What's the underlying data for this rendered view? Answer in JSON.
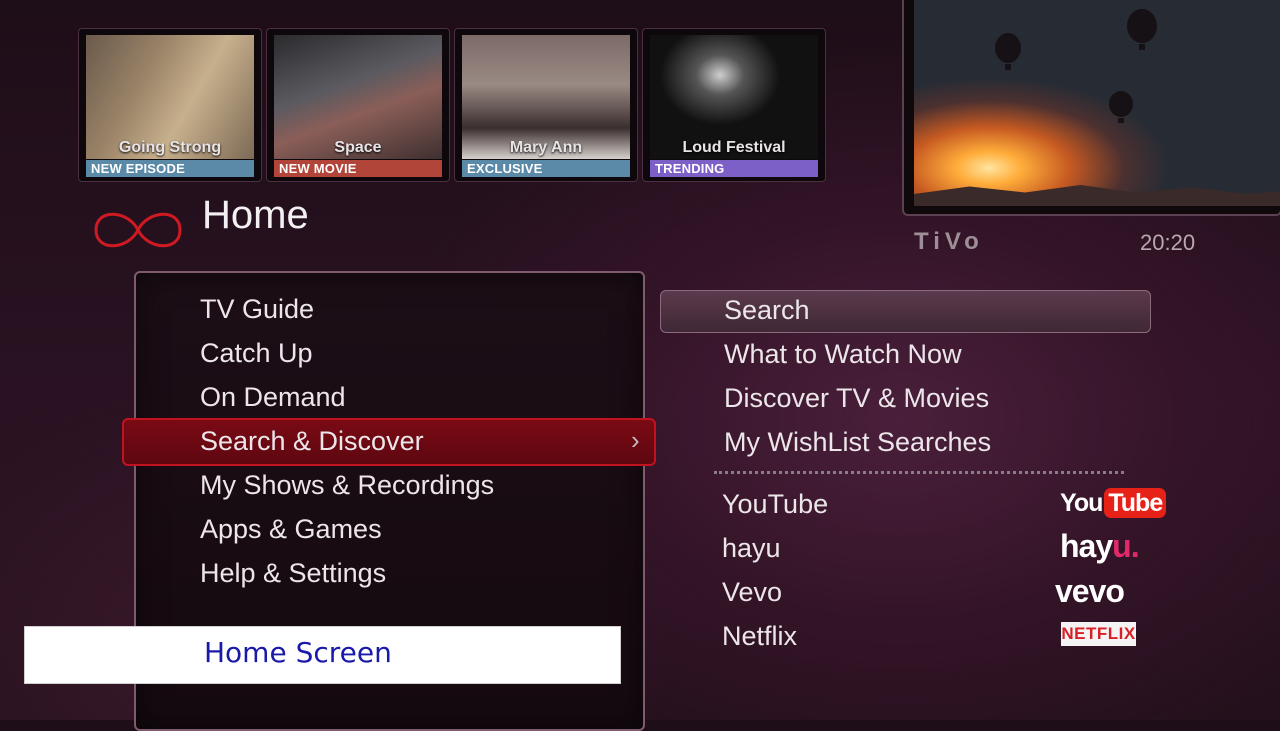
{
  "tiles": [
    {
      "title": "Going Strong",
      "badge": "NEW EPISODE",
      "badge_color": "#5b8aa8"
    },
    {
      "title": "Space",
      "badge": "NEW MOVIE",
      "badge_color": "#b2453a"
    },
    {
      "title": "Mary Ann",
      "badge": "EXCLUSIVE",
      "badge_color": "#5b8aa8"
    },
    {
      "title": "Loud Festival",
      "badge": "TRENDING",
      "badge_color": "#7d5fc8"
    }
  ],
  "header": {
    "title": "Home",
    "brand": "TiVo",
    "clock": "20:20",
    "logo_color": "#d01a22"
  },
  "main_menu": {
    "items": [
      {
        "label": "TV Guide"
      },
      {
        "label": "Catch Up"
      },
      {
        "label": "On Demand"
      },
      {
        "label": "Search & Discover",
        "selected": true
      },
      {
        "label": "My Shows & Recordings"
      },
      {
        "label": "Apps & Games"
      },
      {
        "label": "Help & Settings"
      }
    ],
    "chevron": "›"
  },
  "sub_menu": {
    "items": [
      {
        "label": "Search",
        "focused": true
      },
      {
        "label": "What to Watch Now"
      },
      {
        "label": "Discover TV & Movies"
      },
      {
        "label": "My WishList Searches"
      }
    ],
    "apps": [
      {
        "label": "YouTube",
        "logo": "youtube-logo"
      },
      {
        "label": "hayu",
        "logo": "hayu-logo"
      },
      {
        "label": "Vevo",
        "logo": "vevo-logo"
      },
      {
        "label": "Netflix",
        "logo": "netflix-logo"
      }
    ]
  },
  "logos": {
    "youtube_you": "You",
    "youtube_tube": "Tube",
    "hayu_main": "hay",
    "hayu_u": "u.",
    "vevo": "vevo",
    "netflix": "NETFLIX"
  },
  "caption": "Home Screen"
}
